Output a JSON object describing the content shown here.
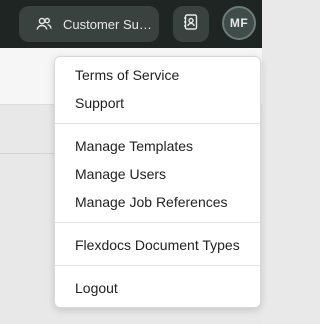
{
  "topbar": {
    "team": {
      "label": "Customer Su…",
      "icon": "users-icon"
    },
    "contacts_icon": "contacts-book-icon",
    "avatar_initials": "MF"
  },
  "menu": {
    "items": [
      {
        "label": "Terms of Service"
      },
      {
        "label": "Support"
      },
      {
        "label": "Manage Templates"
      },
      {
        "label": "Manage Users"
      },
      {
        "label": "Manage Job References"
      },
      {
        "label": "Flexdocs Document Types"
      },
      {
        "label": "Logout"
      }
    ]
  },
  "colors": {
    "topbar_bg": "#1e2523",
    "pill_bg": "#3a4240",
    "menu_bg": "#ffffff"
  }
}
